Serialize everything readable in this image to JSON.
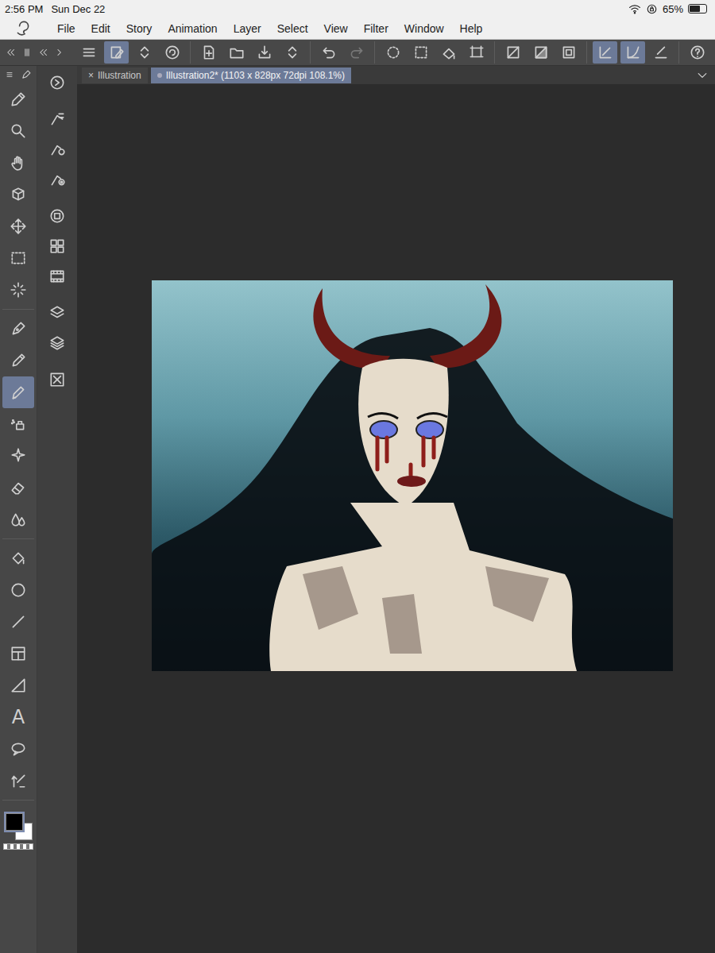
{
  "status_bar": {
    "time": "2:56 PM",
    "date": "Sun Dec 22",
    "battery": "65%",
    "battery_level": 0.65
  },
  "menu": [
    "File",
    "Edit",
    "Story",
    "Animation",
    "Layer",
    "Select",
    "View",
    "Filter",
    "Window",
    "Help"
  ],
  "toolbar": [
    [
      {
        "selected": false,
        "disabled": false
      },
      {
        "selected": true,
        "disabled": false
      },
      {
        "selected": false,
        "disabled": false
      },
      {
        "selected": false,
        "disabled": false
      }
    ],
    [
      {
        "selected": false,
        "disabled": false
      },
      {
        "selected": false,
        "disabled": false
      },
      {
        "selected": false,
        "disabled": false
      },
      {
        "selected": false,
        "disabled": false
      }
    ],
    [
      {
        "selected": false,
        "disabled": false
      },
      {
        "selected": false,
        "disabled": true
      }
    ],
    [
      {
        "selected": false,
        "disabled": false
      },
      {
        "selected": false,
        "disabled": false
      },
      {
        "selected": false,
        "disabled": false
      },
      {
        "selected": false,
        "disabled": false
      }
    ],
    [
      {
        "selected": false,
        "disabled": false
      },
      {
        "selected": false,
        "disabled": false
      },
      {
        "selected": false,
        "disabled": false
      }
    ],
    [
      {
        "selected": true,
        "disabled": false
      },
      {
        "selected": true,
        "disabled": false
      },
      {
        "selected": false,
        "disabled": false
      }
    ],
    [
      {
        "selected": false,
        "disabled": false
      }
    ]
  ],
  "tabs": [
    {
      "label": "Illustration",
      "close": "×",
      "selected": false
    },
    {
      "label": "Illustration2* (1103 x 828px 72dpi 108.1%)",
      "selected": true
    }
  ],
  "tools": [
    [
      {
        "selected": false
      },
      {
        "selected": false
      },
      {
        "selected": false
      },
      {
        "selected": false
      },
      {
        "selected": false
      },
      {
        "selected": false
      },
      {
        "selected": false
      }
    ],
    [
      {
        "selected": false
      },
      {
        "selected": false
      },
      {
        "selected": true
      },
      {
        "selected": false
      },
      {
        "selected": false
      },
      {
        "selected": false
      },
      {
        "selected": false
      }
    ],
    [
      {
        "selected": false
      },
      {
        "selected": false
      },
      {
        "selected": false
      },
      {
        "selected": false
      },
      {
        "selected": false
      },
      {
        "selected": false,
        "glyph": "A"
      },
      {
        "selected": false
      },
      {
        "selected": false
      }
    ]
  ],
  "sub_tools": [
    [
      {
        "selected": false
      }
    ],
    [
      {
        "selected": false
      },
      {
        "selected": false
      },
      {
        "selected": false
      }
    ],
    [
      {
        "selected": false
      },
      {
        "selected": false
      },
      {
        "selected": false
      }
    ],
    [
      {
        "selected": false
      },
      {
        "selected": false
      }
    ],
    [
      {
        "selected": false
      }
    ]
  ],
  "colors": [
    {
      "selected": true,
      "color": "#000000"
    },
    {
      "selected": false,
      "color": "#ffffff"
    }
  ]
}
